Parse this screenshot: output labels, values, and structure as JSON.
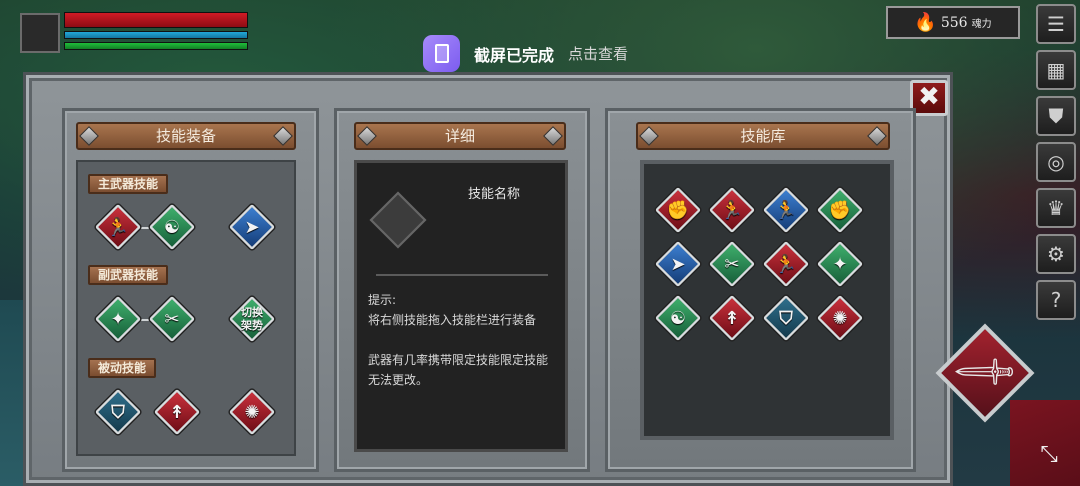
{
  "hud": {
    "soul_value": "556",
    "soul_unit": "魂力",
    "flame_icon": "🔥"
  },
  "notification": {
    "title": "截屏已完成",
    "action": "点击查看"
  },
  "side_menu": [
    {
      "name": "menu-icon",
      "glyph": "☰"
    },
    {
      "name": "map-icon",
      "glyph": "▦"
    },
    {
      "name": "armor-icon",
      "glyph": "⛊"
    },
    {
      "name": "emblem-icon",
      "glyph": "◎"
    },
    {
      "name": "crown-icon",
      "glyph": "♛"
    },
    {
      "name": "gear-icon",
      "glyph": "⚙"
    },
    {
      "name": "help-icon",
      "glyph": "?"
    }
  ],
  "panels": {
    "equip": {
      "title": "技能装备",
      "main_label": "主武器技能",
      "sub_label": "副武器技能",
      "passive_label": "被动技能",
      "switch_label": "切换\n架势"
    },
    "detail": {
      "title": "详细",
      "skill_name": "技能名称",
      "hint_title": "提示:",
      "hint_line1": "将右侧技能拖入技能栏进行装备",
      "hint_line2": "武器有几率携带限定技能限定技能无法更改。"
    },
    "library": {
      "title": "技能库"
    }
  },
  "close_glyph": "✖",
  "expand_glyph": "⤡",
  "attack_glyph": "🗡",
  "skill_glyphs": {
    "kick": "🏃",
    "brain": "☯",
    "arrow": "➤",
    "jump": "✦",
    "shield": "⛉",
    "sword": "↟",
    "burst": "✺",
    "fist": "✊",
    "claw": "✂"
  }
}
